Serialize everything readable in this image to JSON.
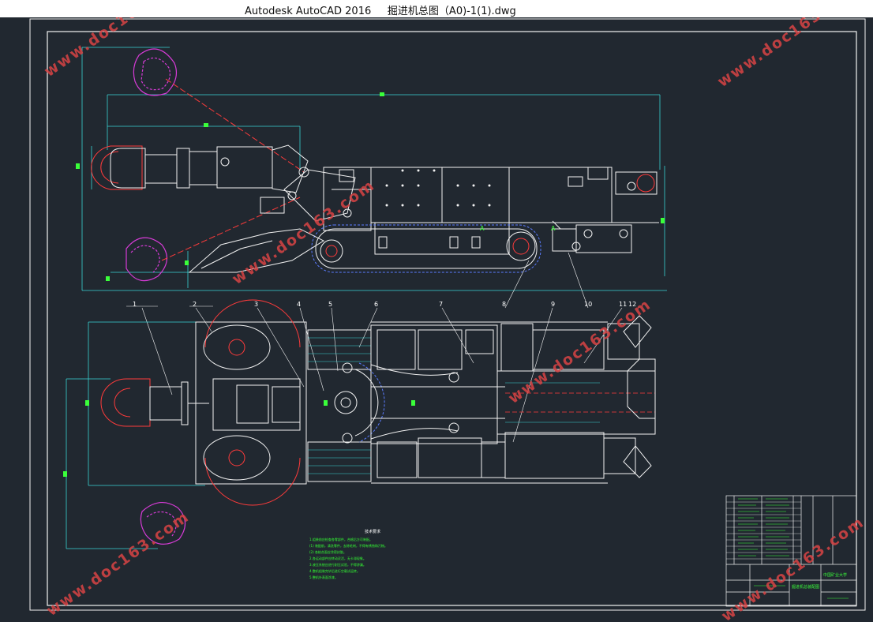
{
  "window": {
    "app_name": "Autodesk AutoCAD 2016",
    "file_name": "掘进机总图（A0)-1(1).dwg"
  },
  "drawing": {
    "part_numbers": [
      "1",
      "2",
      "3",
      "4",
      "5",
      "6",
      "7",
      "8",
      "9",
      "10",
      "11",
      "12"
    ],
    "tech_requirements": {
      "title": "技术要求",
      "lines": [
        "1.组装前应检查各零部件，合格后方可装配。",
        "(1) 装配前，清洗零件，去除毛刺，不得有锈蚀和污物。",
        "(2) 各结合面应涂密封胶。",
        "2.各运动部件应转动灵活，无卡滞现象。",
        "3.液压系统应进行耐压试验，不得渗漏。",
        "4.整机组装完毕后进行空载试运转。",
        "5.整机外表面涂漆。"
      ]
    },
    "title_block": {
      "drawing_name": "掘进机总装配图",
      "school": "中国矿业大学"
    },
    "watermark": "www.doc163.com"
  },
  "colors": {
    "canvas_bg": "#212830",
    "line_white": "#f2f2f2",
    "magenta": "#d63bd6",
    "red": "#ff3b3b",
    "cyan": "#3ad4d4",
    "green": "#3aff3a",
    "blue": "#5b7cff"
  }
}
